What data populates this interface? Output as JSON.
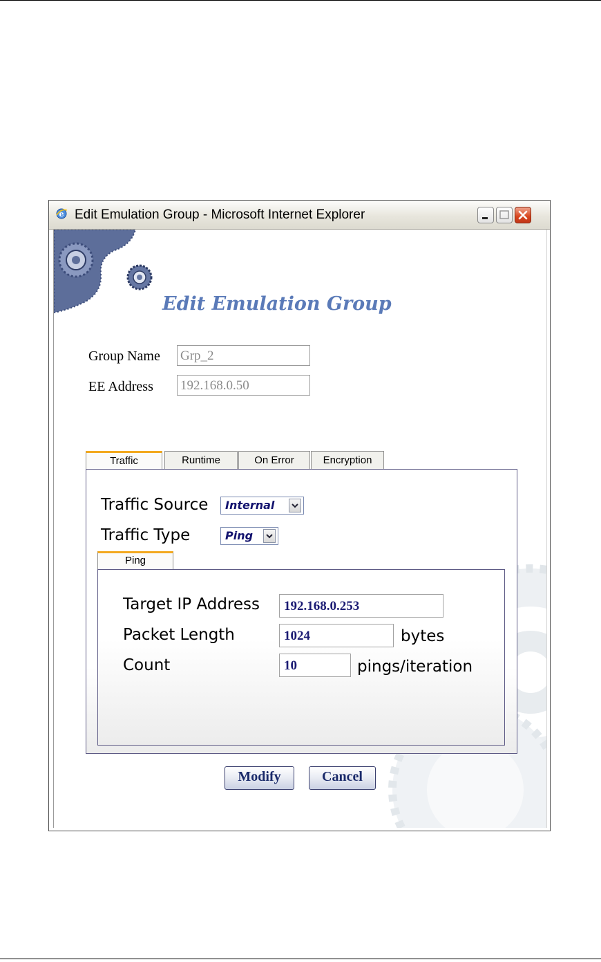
{
  "window": {
    "title": "Edit Emulation Group - Microsoft Internet Explorer",
    "icons": [
      "ie-icon",
      "minimize-icon",
      "maximize-icon",
      "close-icon"
    ]
  },
  "dialog": {
    "heading": "Edit Emulation Group",
    "group_name": {
      "label": "Group Name",
      "value": "Grp_2"
    },
    "ee_address": {
      "label": "EE Address",
      "value": "192.168.0.50"
    }
  },
  "tabs": [
    {
      "label": "Traffic",
      "active": true
    },
    {
      "label": "Runtime",
      "active": false
    },
    {
      "label": "On Error",
      "active": false
    },
    {
      "label": "Encryption",
      "active": false
    }
  ],
  "traffic": {
    "source": {
      "label": "Traffic Source",
      "selected": "Internal"
    },
    "type": {
      "label": "Traffic Type",
      "selected": "Ping"
    },
    "subtab": "Ping",
    "ping": {
      "target_ip": {
        "label": "Target IP Address",
        "value": "192.168.0.253"
      },
      "packet_length": {
        "label": "Packet Length",
        "value": "1024",
        "unit": "bytes"
      },
      "count": {
        "label": "Count",
        "value": "10",
        "unit": "pings/iteration"
      }
    }
  },
  "buttons": {
    "modify": "Modify",
    "cancel": "Cancel"
  },
  "colors": {
    "accent": "#5a7ab8",
    "tab_highlight": "#f3a91f",
    "panel_border": "#5d5a85",
    "field_text": "#1b1b73"
  }
}
